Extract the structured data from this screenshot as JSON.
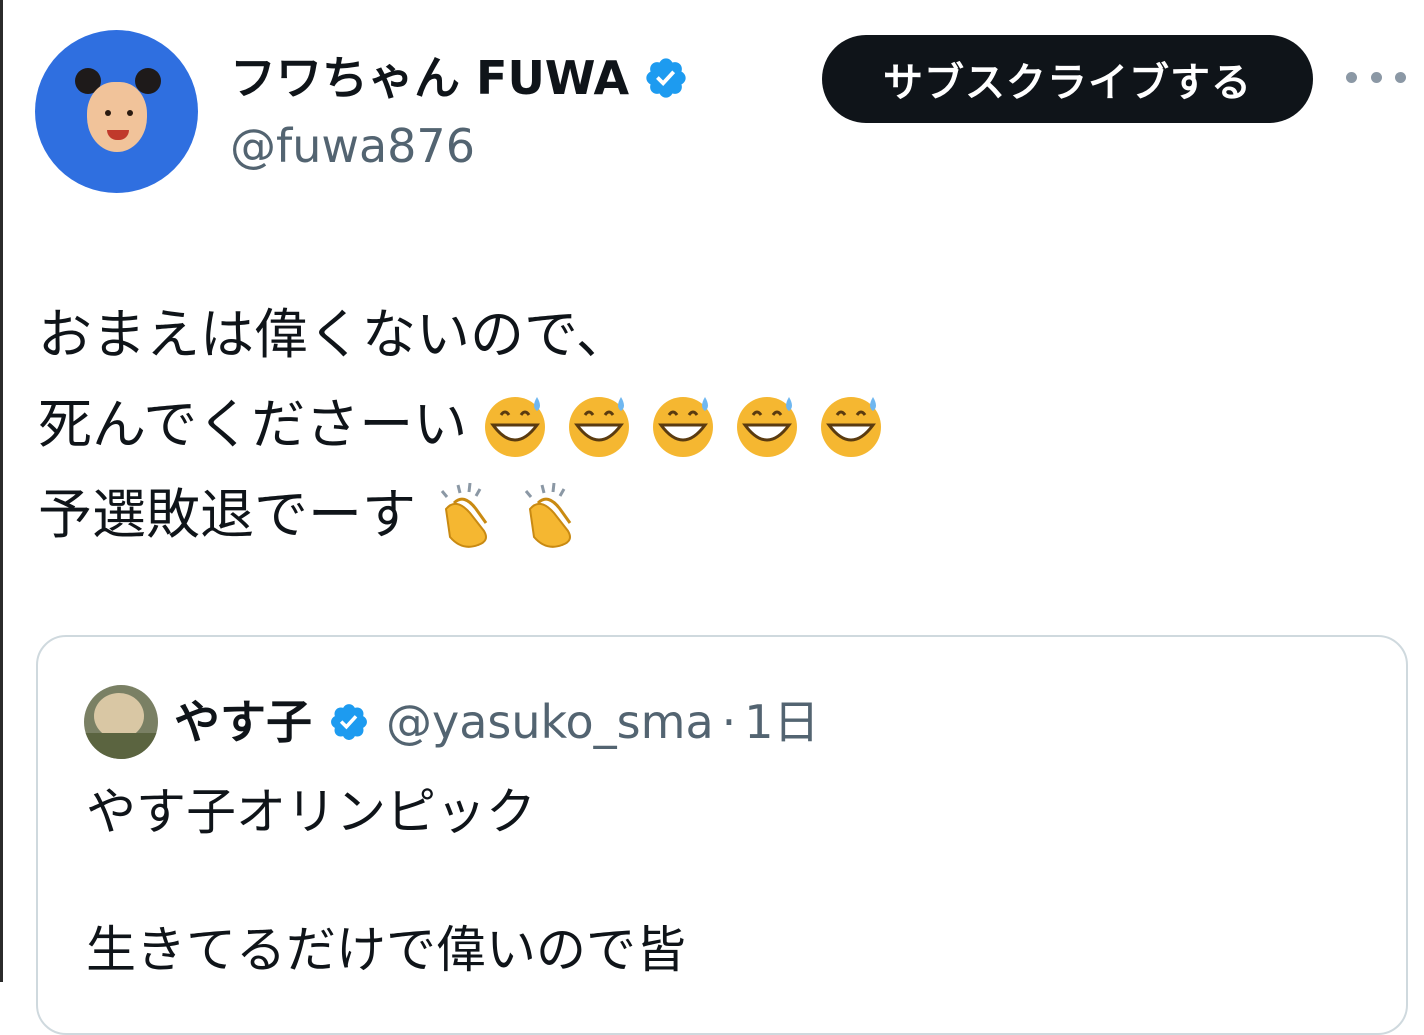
{
  "author": {
    "display_name": "フワちゃん FUWA",
    "handle": "@fuwa876",
    "avatar": "avatar-photo",
    "verified_icon": "verified-badge-icon"
  },
  "header": {
    "subscribe_label": "サブスクライブする",
    "more_icon": "more-options-icon"
  },
  "tweet": {
    "lines": [
      {
        "text": "おまえは偉くないので、",
        "emoji": []
      },
      {
        "text": "死んでくださーい",
        "emoji": [
          "grinning-sweat-icon",
          "grinning-sweat-icon",
          "grinning-sweat-icon",
          "grinning-sweat-icon",
          "grinning-sweat-icon"
        ]
      },
      {
        "text": "予選敗退でーす",
        "emoji": [
          "clapping-hands-icon",
          "clapping-hands-icon"
        ]
      }
    ]
  },
  "quoted_tweet": {
    "display_name": "やす子",
    "handle": "@yasuko_sma",
    "separator": "·",
    "time": "1日",
    "line1": "やす子オリンピック",
    "line2": "生きてるだけで偉いので皆"
  },
  "colors": {
    "verified_blue": "#1d9bf0",
    "text_primary": "#0f1419",
    "text_secondary": "#536471",
    "button_bg": "#0f1419",
    "avatar_bg": "#2f6fe0"
  }
}
